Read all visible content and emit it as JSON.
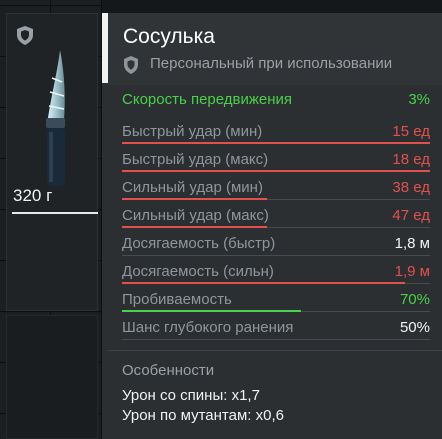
{
  "item": {
    "title": "Сосулька",
    "subtitle": "Персональный при использовании",
    "weight": "320 г",
    "badge_icon": "shield-icon",
    "image_icon": "icicle-knife-icon"
  },
  "colors": {
    "green": "#4bd04b",
    "red": "#e2504e",
    "white": "#f2f2f2",
    "label": "#8f969b",
    "panel": "#2b2f32"
  },
  "stats": [
    {
      "label": "Скорость передвижения",
      "value": "3%",
      "color": "green",
      "fill": 0
    },
    {
      "label": "Быстрый удар (мин)",
      "value": "15 ед",
      "color": "red",
      "fill": 1.0
    },
    {
      "label": "Быстрый удар (макс)",
      "value": "18 ед",
      "color": "red",
      "fill": 1.0
    },
    {
      "label": "Сильный удар (мин)",
      "value": "38 ед",
      "color": "red",
      "fill": 0.47
    },
    {
      "label": "Сильный удар (макс)",
      "value": "47 ед",
      "color": "red",
      "fill": 0.47
    },
    {
      "label": "Досягаемость (быстр)",
      "value": "1,8 м",
      "color": "white",
      "fill": 0
    },
    {
      "label": "Досягаемость (сильн)",
      "value": "1,9 м",
      "color": "red",
      "fill": 0.92
    },
    {
      "label": "Пробиваемость",
      "value": "70%",
      "color": "green",
      "fill": 0.58
    },
    {
      "label": "Шанс глубокого ранения",
      "value": "50%",
      "color": "white",
      "fill": 0
    }
  ],
  "features": {
    "title": "Особенности",
    "items": [
      "Урон со спины: x1,7",
      "Урон по мутантам: x0,6"
    ]
  }
}
